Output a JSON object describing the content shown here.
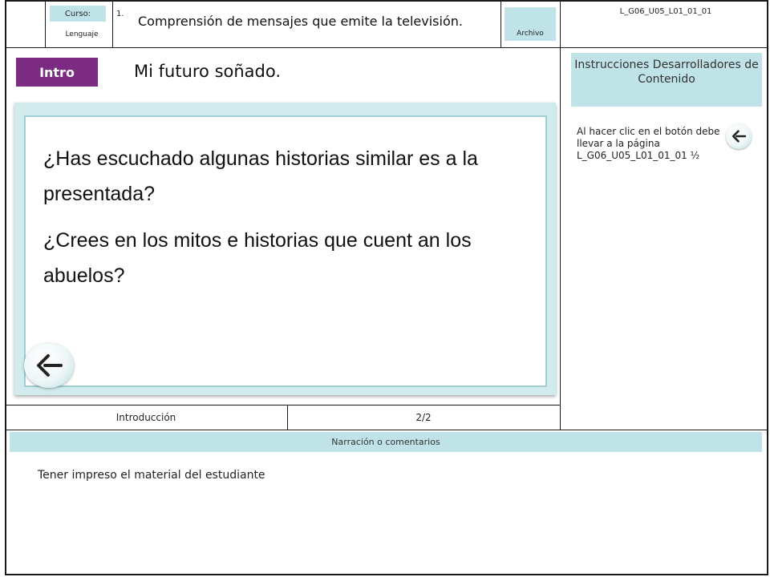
{
  "header": {
    "course_label": "Curso:",
    "course_value": "Lenguaje",
    "number": "1.",
    "title": "Comprensión de mensajes que emite la televisión.",
    "archivo_label": "Archivo",
    "file_code": "L_G06_U05_L01_01_01"
  },
  "slide": {
    "badge": "Intro",
    "title": "Mi futuro soñado.",
    "questions": [
      "¿Has escuchado algunas historias similar es a la presentada?",
      "¿Crees en los mitos e historias que cuent an los abuelos?"
    ],
    "back_icon": "back-arrow-icon"
  },
  "instructions": {
    "header": "Instrucciones Desarrolladores de Contenido",
    "text": "Al hacer clic en el botón debe llevar a la página L_G06_U05_L01_01_01 ½"
  },
  "footer": {
    "section": "Introducción",
    "page": "2/2"
  },
  "narration": {
    "header": "Narración o comentarios",
    "text": "Tener impreso el material del estudiante"
  },
  "colors": {
    "accent_purple": "#7b2b82",
    "panel_cyan": "#bfe3e6"
  }
}
